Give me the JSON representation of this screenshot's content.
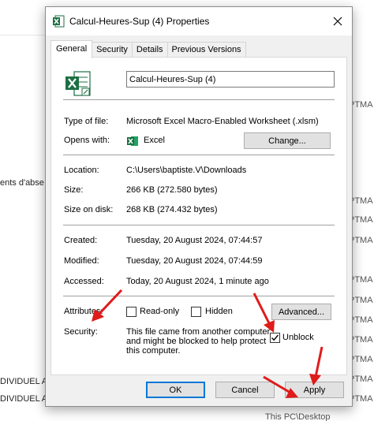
{
  "background": {
    "left_texts": [
      "ents d'abse",
      "DIVIDUEL A",
      "DIVIDUEL A"
    ],
    "right_texts": [
      "PTMA",
      "PTMA",
      "PTMA",
      "PTMA",
      "PTMA",
      "PTMA",
      "PTMA",
      "PTMA",
      "PTMA",
      "PTMA",
      "PTMA"
    ],
    "bottom_text": "This PC\\Desktop"
  },
  "dialog": {
    "title": "Calcul-Heures-Sup (4) Properties",
    "tabs": [
      {
        "label": "General",
        "active": true
      },
      {
        "label": "Security",
        "active": false
      },
      {
        "label": "Details",
        "active": false
      },
      {
        "label": "Previous Versions",
        "active": false
      }
    ],
    "file_name": "Calcul-Heures-Sup (4)",
    "type_of_file": {
      "label": "Type of file:",
      "value": "Microsoft Excel Macro-Enabled Worksheet (.xlsm)"
    },
    "opens_with": {
      "label": "Opens with:",
      "value": "Excel",
      "button": "Change..."
    },
    "location": {
      "label": "Location:",
      "value": "C:\\Users\\baptiste.V\\Downloads"
    },
    "size": {
      "label": "Size:",
      "value": "266 KB (272.580 bytes)"
    },
    "size_on_disk": {
      "label": "Size on disk:",
      "value": "268 KB (274.432 bytes)"
    },
    "created": {
      "label": "Created:",
      "value": "Tuesday, 20 August 2024, 07:44:57"
    },
    "modified": {
      "label": "Modified:",
      "value": "Tuesday, 20 August 2024, 07:44:59"
    },
    "accessed": {
      "label": "Accessed:",
      "value": "Today, 20 August 2024, 1 minute ago"
    },
    "attributes": {
      "label": "Attributes:",
      "read_only": {
        "label": "Read-only",
        "checked": false
      },
      "hidden": {
        "label": "Hidden",
        "checked": false
      },
      "advanced_button": "Advanced..."
    },
    "security": {
      "label": "Security:",
      "message": "This file came from another computer and might be blocked to help protect this computer.",
      "unblock": {
        "label": "Unblock",
        "checked": true
      }
    },
    "buttons": {
      "ok": "OK",
      "cancel": "Cancel",
      "apply": "Apply"
    }
  },
  "colors": {
    "excel_green": "#1d6f42",
    "arrow_red": "#e01b1b",
    "accent": "#0078d7"
  },
  "icons": [
    "excel-file-icon",
    "close-icon",
    "check-icon",
    "red-arrow-icon"
  ]
}
